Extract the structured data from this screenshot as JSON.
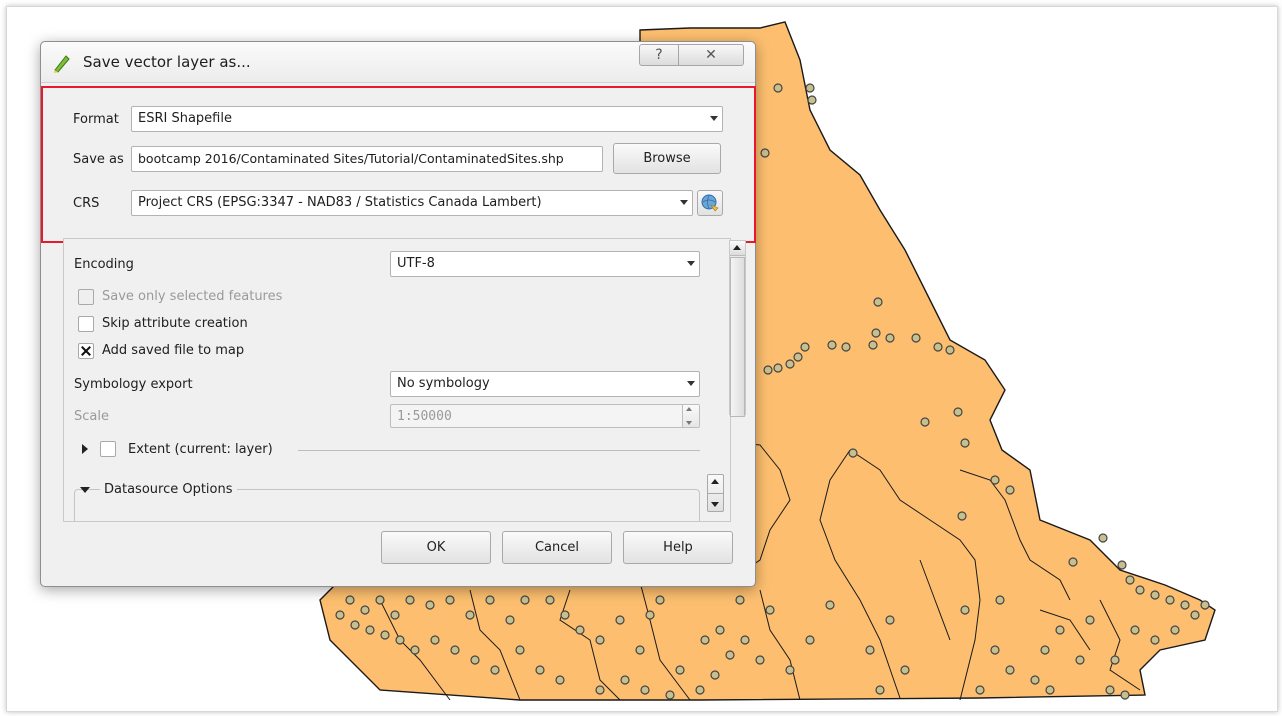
{
  "dialog": {
    "title": "Save vector layer as...",
    "help_symbol": "?",
    "close_symbol": "✕",
    "app_icon": "qgis-icon"
  },
  "form": {
    "format_label": "Format",
    "format_value": "ESRI Shapefile",
    "save_as_label": "Save as",
    "save_as_value": "bootcamp 2016/Contaminated Sites/Tutorial/ContaminatedSites.shp",
    "browse_label": "Browse",
    "crs_label": "CRS",
    "crs_value": "Project CRS (EPSG:3347 - NAD83 / Statistics Canada Lambert)",
    "crs_button_icon": "globe-crs-icon"
  },
  "options": {
    "encoding_label": "Encoding",
    "encoding_value": "UTF-8",
    "save_selected_label": "Save only selected features",
    "save_selected_checked": false,
    "save_selected_enabled": false,
    "skip_attr_label": "Skip attribute creation",
    "skip_attr_checked": false,
    "add_to_map_label": "Add saved file to map",
    "add_to_map_checked": true,
    "symbology_label": "Symbology export",
    "symbology_value": "No symbology",
    "scale_label": "Scale",
    "scale_value": "1:50000",
    "extent_label": "Extent (current: layer)",
    "datasource_label": "Datasource Options"
  },
  "buttons": {
    "ok": "OK",
    "cancel": "Cancel",
    "help": "Help"
  },
  "colors": {
    "highlight": "#e8192c",
    "map_fill": "#fdbf6f",
    "map_boundary": "#1a1a1a",
    "site_marker": "#c8bf8e"
  }
}
